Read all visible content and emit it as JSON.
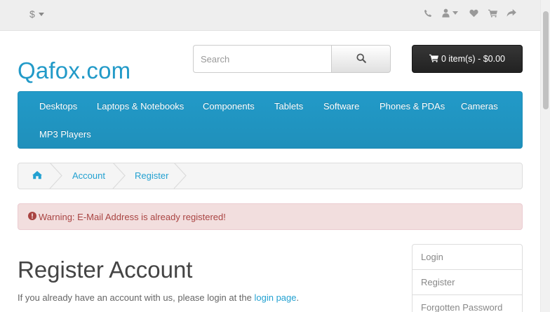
{
  "topbar": {
    "currency_symbol": "$",
    "icons": [
      "phone-icon",
      "user-icon",
      "heart-icon",
      "cart-icon",
      "share-icon"
    ]
  },
  "header": {
    "logo": "Qafox.com",
    "search_placeholder": "Search",
    "cart_label": "0 item(s) - $0.00"
  },
  "menu": {
    "items": [
      "Desktops",
      "Laptops & Notebooks",
      "Components",
      "Tablets",
      "Software",
      "Phones & PDAs",
      "Cameras",
      "MP3 Players"
    ]
  },
  "breadcrumb": {
    "items": [
      "Account",
      "Register"
    ]
  },
  "alert": {
    "text": "Warning: E-Mail Address is already registered!"
  },
  "main": {
    "title": "Register Account",
    "intro_prefix": "If you already have an account with us, please login at the ",
    "intro_link": "login page",
    "intro_suffix": "."
  },
  "sidebar": {
    "items": [
      "Login",
      "Register",
      "Forgotten Password"
    ]
  },
  "colors": {
    "accent": "#229ac8",
    "alert_bg": "#f2dede",
    "alert_text": "#a94442"
  }
}
